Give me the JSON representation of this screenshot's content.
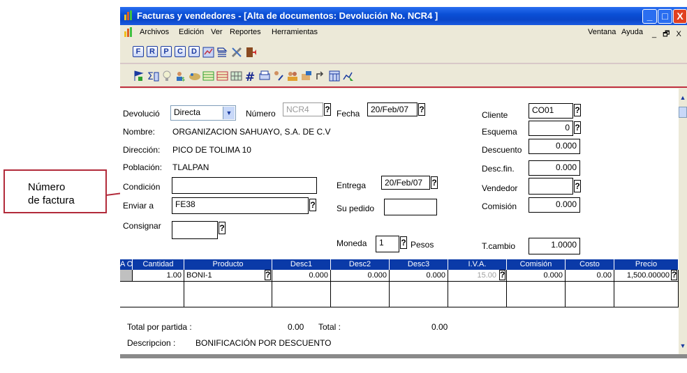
{
  "callout": {
    "line1": "Número",
    "line2": "de factura"
  },
  "window": {
    "title": "Facturas y vendedores - [Alta de documentos: Devolución No. NCR4  ]",
    "buttons": {
      "minimize": "_",
      "maximize": "□",
      "close": "X"
    }
  },
  "menu": {
    "items": [
      "Archivos",
      "Edición",
      "Ver",
      "Reportes",
      "Herramientas"
    ],
    "right": [
      "Ventana",
      "Ayuda"
    ],
    "controls": "_ 🗗 X"
  },
  "toolbar1": {
    "buttons": [
      "F",
      "R",
      "P",
      "C",
      "D"
    ]
  },
  "form": {
    "devolucion_label": "Devolució",
    "devolucion_value": "Directa",
    "numero_label": "Número",
    "numero_value": "NCR4",
    "fecha_label": "Fecha",
    "fecha_value": "20/Feb/07",
    "cliente_label": "Cliente",
    "cliente_value": "CO01",
    "nombre_label": "Nombre:",
    "nombre_value": "ORGANIZACION SAHUAYO, S.A. DE C.V",
    "esquema_label": "Esquema",
    "esquema_value": "0",
    "direccion_label": "Dirección:",
    "direccion_value": "PICO DE TOLIMA 10",
    "descuento_label": "Descuento",
    "descuento_value": "0.000",
    "poblacion_label": "Población:",
    "poblacion_value": "TLALPAN",
    "descfin_label": "Desc.fin.",
    "descfin_value": "0.000",
    "condicion_label": "Condición",
    "condicion_value": "",
    "entrega_label": "Entrega",
    "entrega_value": "20/Feb/07",
    "vendedor_label": "Vendedor",
    "vendedor_value": "",
    "enviar_label": "Enviar a",
    "enviar_value": "FE38",
    "supedido_label": "Su pedido",
    "supedido_value": "",
    "comision_label": "Comisión",
    "comision_value": "0.000",
    "consignar_label": "Consignar",
    "consignar_value": "",
    "moneda_label": "Moneda",
    "moneda_value": "1",
    "moneda_name": "Pesos",
    "tcambio_label": "T.cambio",
    "tcambio_value": "1.0000",
    "q": "?"
  },
  "grid": {
    "headers": [
      "A O",
      "Cantidad",
      "Producto",
      "Desc1",
      "Desc2",
      "Desc3",
      "I.V.A.",
      "Comisión",
      "Costo",
      "Precio"
    ],
    "row": {
      "cantidad": "1.00",
      "producto": "BONI-1",
      "desc1": "0.000",
      "desc2": "0.000",
      "desc3": "0.000",
      "iva": "15.00",
      "comision": "0.000",
      "costo": "0.00",
      "precio": "1,500.00000"
    }
  },
  "footer": {
    "total_partida_label": "Total por partida :",
    "total_partida_value": "0.00",
    "total_label": "Total :",
    "total_value": "0.00",
    "descripcion_label": "Descripcion :",
    "descripcion_value": "BONIFICACIÓN POR DESCUENTO"
  },
  "colors": {
    "titlebar": "#0a4fd6",
    "grid_header": "#0a3aa8",
    "callout_border": "#b22a3a",
    "toolbar_separator": "#c03040"
  }
}
